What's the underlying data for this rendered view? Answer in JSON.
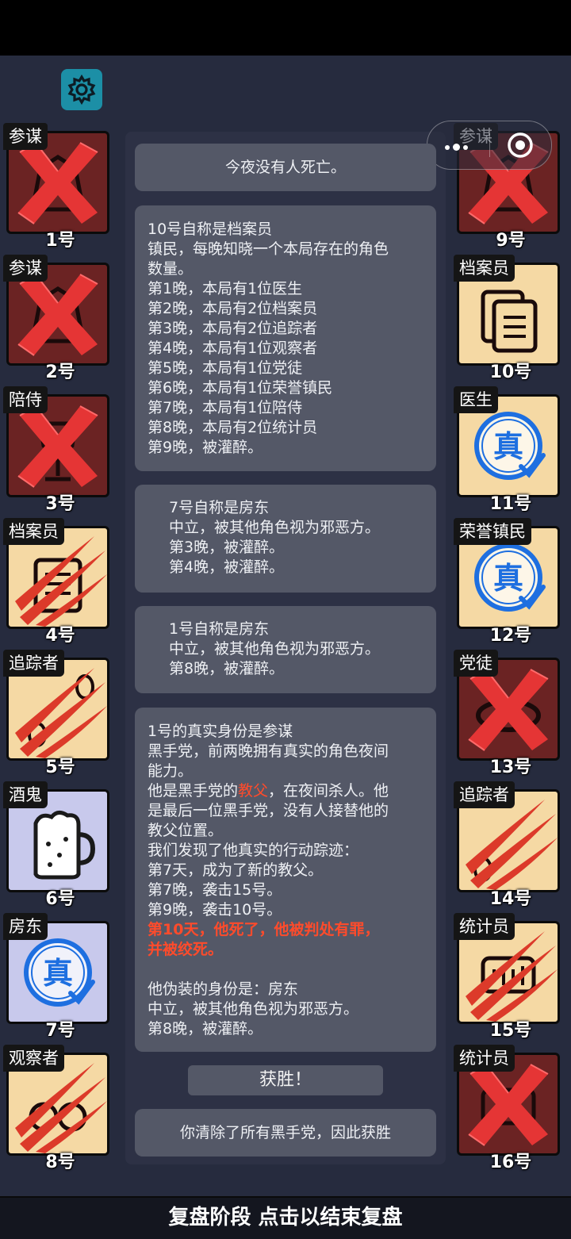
{
  "topbar": {
    "settings_icon": "gear-icon"
  },
  "capsule": {
    "menu_icon": "more-dots-icon",
    "close_icon": "target-circle-icon"
  },
  "players_left": [
    {
      "num": "1号",
      "role": "参谋",
      "state": "dead"
    },
    {
      "num": "2号",
      "role": "参谋",
      "state": "dead"
    },
    {
      "num": "3号",
      "role": "陪侍",
      "state": "dead"
    },
    {
      "num": "4号",
      "role": "档案员",
      "state": "scratched"
    },
    {
      "num": "5号",
      "role": "追踪者",
      "state": "scratched"
    },
    {
      "num": "6号",
      "role": "酒鬼",
      "state": "alive"
    },
    {
      "num": "7号",
      "role": "房东",
      "state": "verified"
    },
    {
      "num": "8号",
      "role": "观察者",
      "state": "scratched"
    }
  ],
  "players_right": [
    {
      "num": "9号",
      "role": "参谋",
      "state": "dead"
    },
    {
      "num": "10号",
      "role": "档案员",
      "state": "alive"
    },
    {
      "num": "11号",
      "role": "医生",
      "state": "verified"
    },
    {
      "num": "12号",
      "role": "荣誉镇民",
      "state": "verified"
    },
    {
      "num": "13号",
      "role": "党徒",
      "state": "dead"
    },
    {
      "num": "14号",
      "role": "追踪者",
      "state": "scratched"
    },
    {
      "num": "15号",
      "role": "统计员",
      "state": "scratched"
    },
    {
      "num": "16号",
      "role": "统计员",
      "state": "dead"
    }
  ],
  "verified_stamp": "真",
  "messages": {
    "m0": {
      "l0": "今夜没有人死亡。"
    },
    "m1": {
      "l0": "10号自称是档案员",
      "l1": "镇民，每晚知晓一个本局存在的角色",
      "l2": "数量。",
      "l3": "第1晚，本局有1位医生",
      "l4": "第2晚，本局有2位档案员",
      "l5": "第3晚，本局有2位追踪者",
      "l6": "第4晚，本局有1位观察者",
      "l7": "第5晚，本局有1位党徒",
      "l8": "第6晚，本局有1位荣誉镇民",
      "l9": "第7晚，本局有1位陪侍",
      "l10": "第8晚，本局有2位统计员",
      "l11": "第9晚，被灌醉。"
    },
    "m2": {
      "l0": "7号自称是房东",
      "l1": "中立，被其他角色视为邪恶方。",
      "l2": "第3晚，被灌醉。",
      "l3": "第4晚，被灌醉。"
    },
    "m3": {
      "l0": "1号自称是房东",
      "l1": "中立，被其他角色视为邪恶方。",
      "l2": "第8晚，被灌醉。"
    },
    "m4": {
      "l0": "1号的真实身份是参谋",
      "l1": "黑手党，前两晚拥有真实的角色夜间",
      "l2": "能力。",
      "l3a": "他是黑手党的",
      "l3b": "教父",
      "l3c": "，在夜间杀人。他",
      "l4": "是最后一位黑手党，没有人接替他的",
      "l5": "教父位置。",
      "l6": "我们发现了他真实的行动踪迹：",
      "l7": "第7天，成为了新的教父。",
      "l8": "第7晚，袭击15号。",
      "l9": "第9晚，袭击10号。",
      "l10": "第10天，他死了，他被判处有罪，",
      "l11": "并被绞死。",
      "l12": "他伪装的身份是：房东",
      "l13": "中立，被其他角色视为邪恶方。",
      "l14": "第8晚，被灌醉。"
    },
    "victory": "获胜！",
    "final": "你清除了所有黑手党，因此获胜"
  },
  "bottom_bar": "复盘阶段 点击以结束复盘",
  "colors": {
    "background": "#262b3e",
    "bubble": "#545867",
    "highlight_red": "#ff4b2b",
    "alive_card": "#f5d9a4",
    "dead_card": "#6b2323",
    "neutral_card": "#c8c9ec",
    "verified_blue": "#1e6fe0",
    "settings_teal": "#1c8fa6"
  }
}
